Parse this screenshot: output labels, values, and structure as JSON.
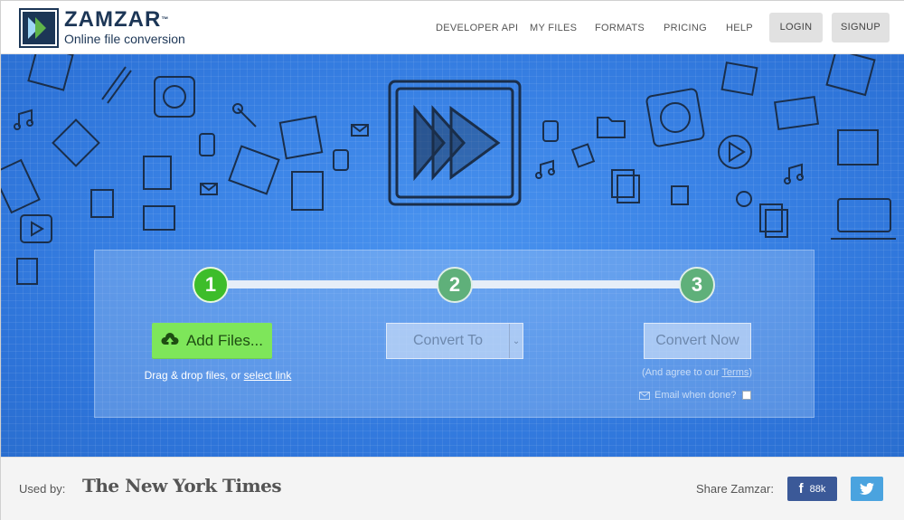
{
  "header": {
    "logo_name": "ZAMZAR",
    "logo_tm": "™",
    "logo_tagline": "Online file conversion",
    "nav": [
      {
        "label": "DEVELOPER API"
      },
      {
        "label": "MY FILES"
      },
      {
        "label": "FORMATS"
      },
      {
        "label": "PRICING"
      },
      {
        "label": "HELP"
      }
    ],
    "login_label": "LOGIN",
    "signup_label": "SIGNUP"
  },
  "steps": {
    "step1": "1",
    "step2": "2",
    "step3": "3",
    "add_files_label": "Add Files...",
    "drop_text": "Drag & drop files, or ",
    "select_link": "select link",
    "convert_to_label": "Convert To",
    "convert_now_label": "Convert Now",
    "agree_prefix": "(And agree to our ",
    "terms_link": "Terms",
    "agree_suffix": ")",
    "email_label": "Email when done?"
  },
  "footer": {
    "used_by": "Used by:",
    "nyt": "The New York Times",
    "share_label": "Share Zamzar:",
    "fb_count": "88k"
  },
  "colors": {
    "brand_navy": "#1c3656",
    "hero_blue": "#2f7ae0",
    "add_green": "#7ee65a",
    "step_active": "#3dbd2a",
    "facebook": "#3b5998",
    "twitter": "#4aa3df"
  }
}
